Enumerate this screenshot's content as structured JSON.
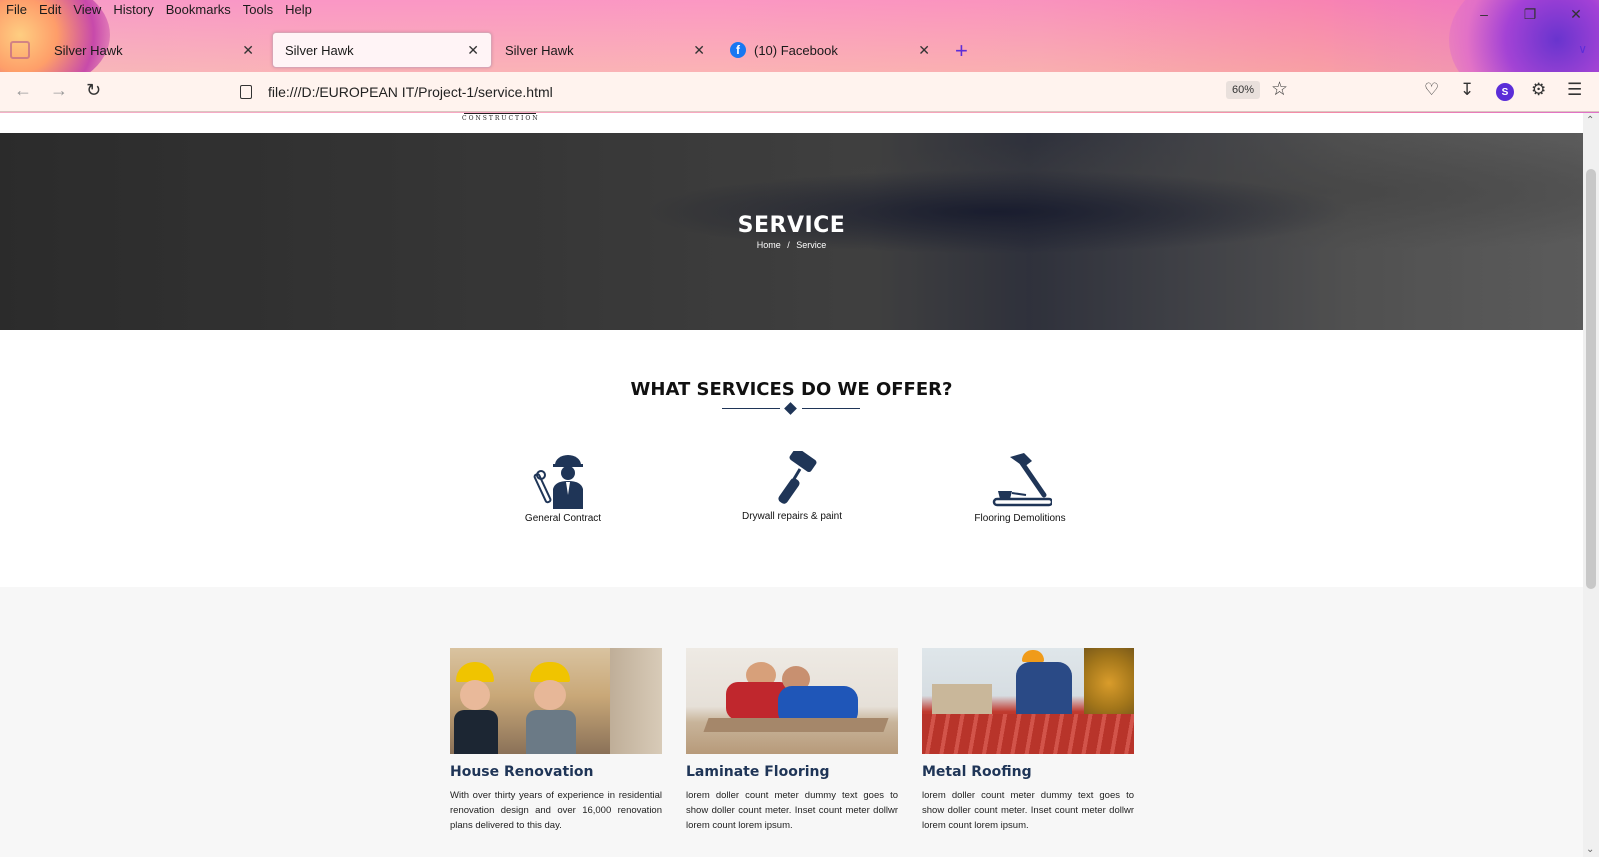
{
  "menu": [
    "File",
    "Edit",
    "View",
    "History",
    "Bookmarks",
    "Tools",
    "Help"
  ],
  "tabs": [
    {
      "title": "Silver Hawk"
    },
    {
      "title": "Silver Hawk"
    },
    {
      "title": "Silver Hawk"
    },
    {
      "title": "(10) Facebook"
    }
  ],
  "address": {
    "url": "file:///D:/EUROPEAN IT/Project-1/service.html",
    "zoom": "60%"
  },
  "profile_initial": "S",
  "hero": {
    "title": "SERVICE",
    "breadcrumb_home": "Home",
    "breadcrumb_sep": "/",
    "breadcrumb_current": "Service"
  },
  "offer": {
    "title": "WHAT SERVICES DO WE OFFER?",
    "services": [
      {
        "label": "General Contract",
        "icon": "worker-icon"
      },
      {
        "label": "Drywall repairs & paint",
        "icon": "paint-roller-icon"
      },
      {
        "label": "Flooring Demolitions",
        "icon": "hammer-icon"
      }
    ]
  },
  "cards": [
    {
      "title": "House Renovation",
      "text": "With over thirty years of experience in residential renovation design and over 16,000 renovation plans delivered to this day."
    },
    {
      "title": "Laminate Flooring",
      "text": "lorem doller count meter dummy text goes to show doller count meter. Inset count meter dollwr lorem count lorem ipsum."
    },
    {
      "title": "Metal Roofing",
      "text": "lorem doller count meter dummy text goes to show doller count meter. Inset count meter dollwr lorem count lorem ipsum."
    }
  ],
  "colors": {
    "accent": "#1f3557",
    "browser_accent": "#5b2dd8"
  }
}
